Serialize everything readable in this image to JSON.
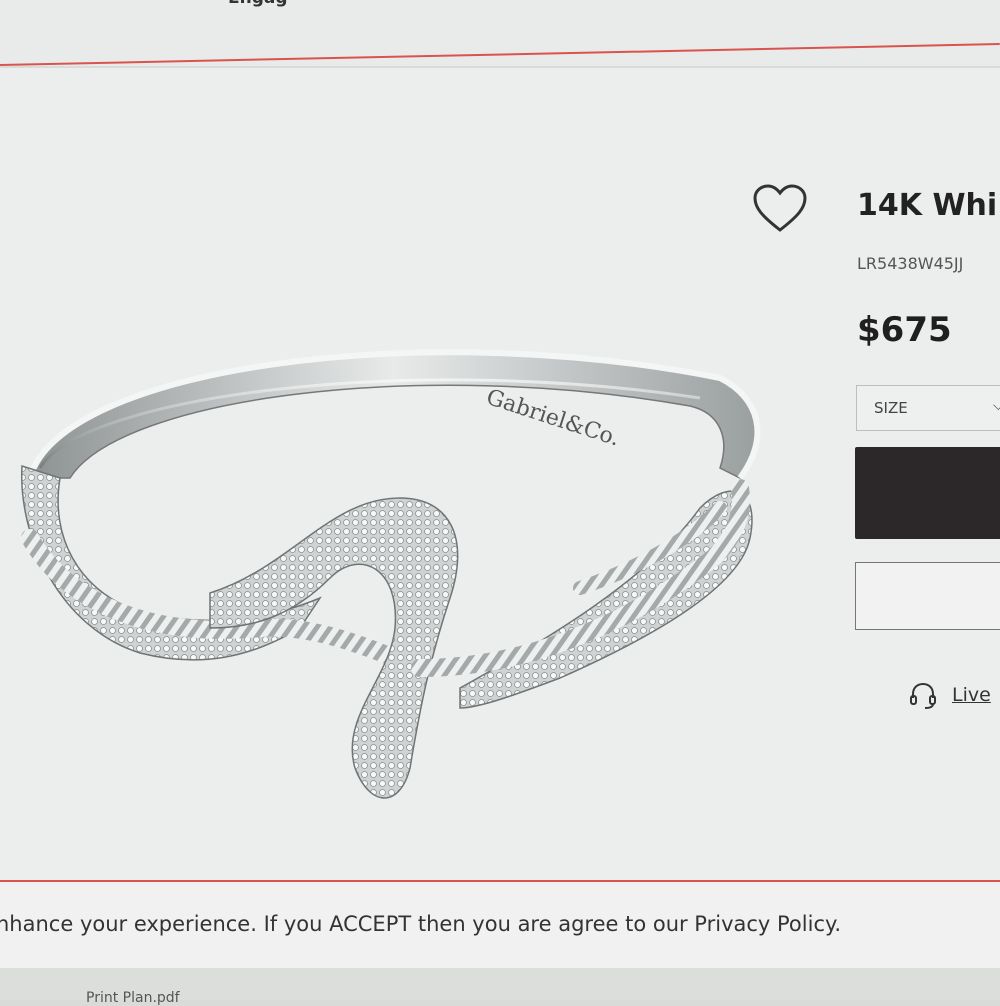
{
  "nav": {
    "partial_link": "Engag"
  },
  "product": {
    "title": "14K Whi",
    "sku": "LR5438W45JJ",
    "price": "$675",
    "size_label": "SIZE",
    "engraving": "Gabriel&Co.",
    "live_chat": "Live"
  },
  "cookie": {
    "text": "nhance your experience. If you ACCEPT then you are agree to our Privacy Policy."
  },
  "bottom": {
    "link1": "Print  Plan.pdf"
  },
  "colors": {
    "accent_line": "#d9534f",
    "button_dark": "#2c2829"
  },
  "icons": {
    "wishlist": "heart-icon",
    "select": "chevron-down-icon",
    "chat": "headset-icon"
  }
}
